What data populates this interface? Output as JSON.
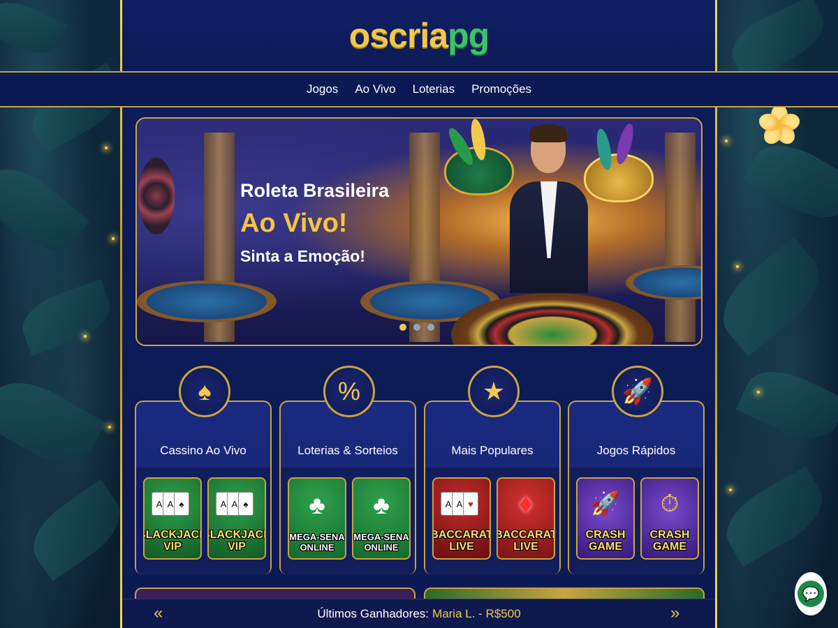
{
  "brand": {
    "logo_part1": "oscria",
    "logo_part2": "pg"
  },
  "nav": {
    "items": [
      {
        "label": "Jogos"
      },
      {
        "label": "Ao Vivo"
      },
      {
        "label": "Loterias"
      },
      {
        "label": "Promoções"
      }
    ]
  },
  "hero": {
    "line1": "Roleta Brasileira",
    "line2": "Ao Vivo!",
    "line3": "Sinta a Emoção!",
    "slides": 3,
    "active_slide": 1
  },
  "categories": [
    {
      "title": "Cassino Ao Vivo",
      "icon": "spade-icon",
      "tiles": [
        {
          "label": "BLACKJACK VIP",
          "icon": "playing-cards-icon"
        },
        {
          "label": "BLACKJACK VIP",
          "icon": "playing-cards-icon"
        }
      ]
    },
    {
      "title": "Loterias & Sorteios",
      "icon": "percent-icon",
      "tiles": [
        {
          "label": "MEGA-SENA ONLINE",
          "icon": "clover-icon"
        },
        {
          "label": "MEGA-SENA ONLINE",
          "icon": "clover-icon"
        }
      ]
    },
    {
      "title": "Mais Populares",
      "icon": "star-icon",
      "tiles": [
        {
          "label": "BACCARAT LIVE",
          "icon": "playing-cards-icon"
        },
        {
          "label": "BACCARAT LIVE",
          "icon": "diamond-icon"
        }
      ]
    },
    {
      "title": "Jogos Rápidos",
      "icon": "rocket-icon",
      "tiles": [
        {
          "label": "CRASH GAME",
          "icon": "rocket-icon"
        },
        {
          "label": "CRASH GAME",
          "icon": "stopwatch-icon"
        }
      ]
    }
  ],
  "ticker": {
    "label": "Últimos Ganhadores:",
    "value": "Maria L. - R$500",
    "prev_glyph": "«",
    "next_glyph": "»"
  },
  "colors": {
    "gold": "#c9a441",
    "accent_yellow": "#f2c94c",
    "navy": "#0e1c5c",
    "logo_green": "#3cc36a"
  }
}
